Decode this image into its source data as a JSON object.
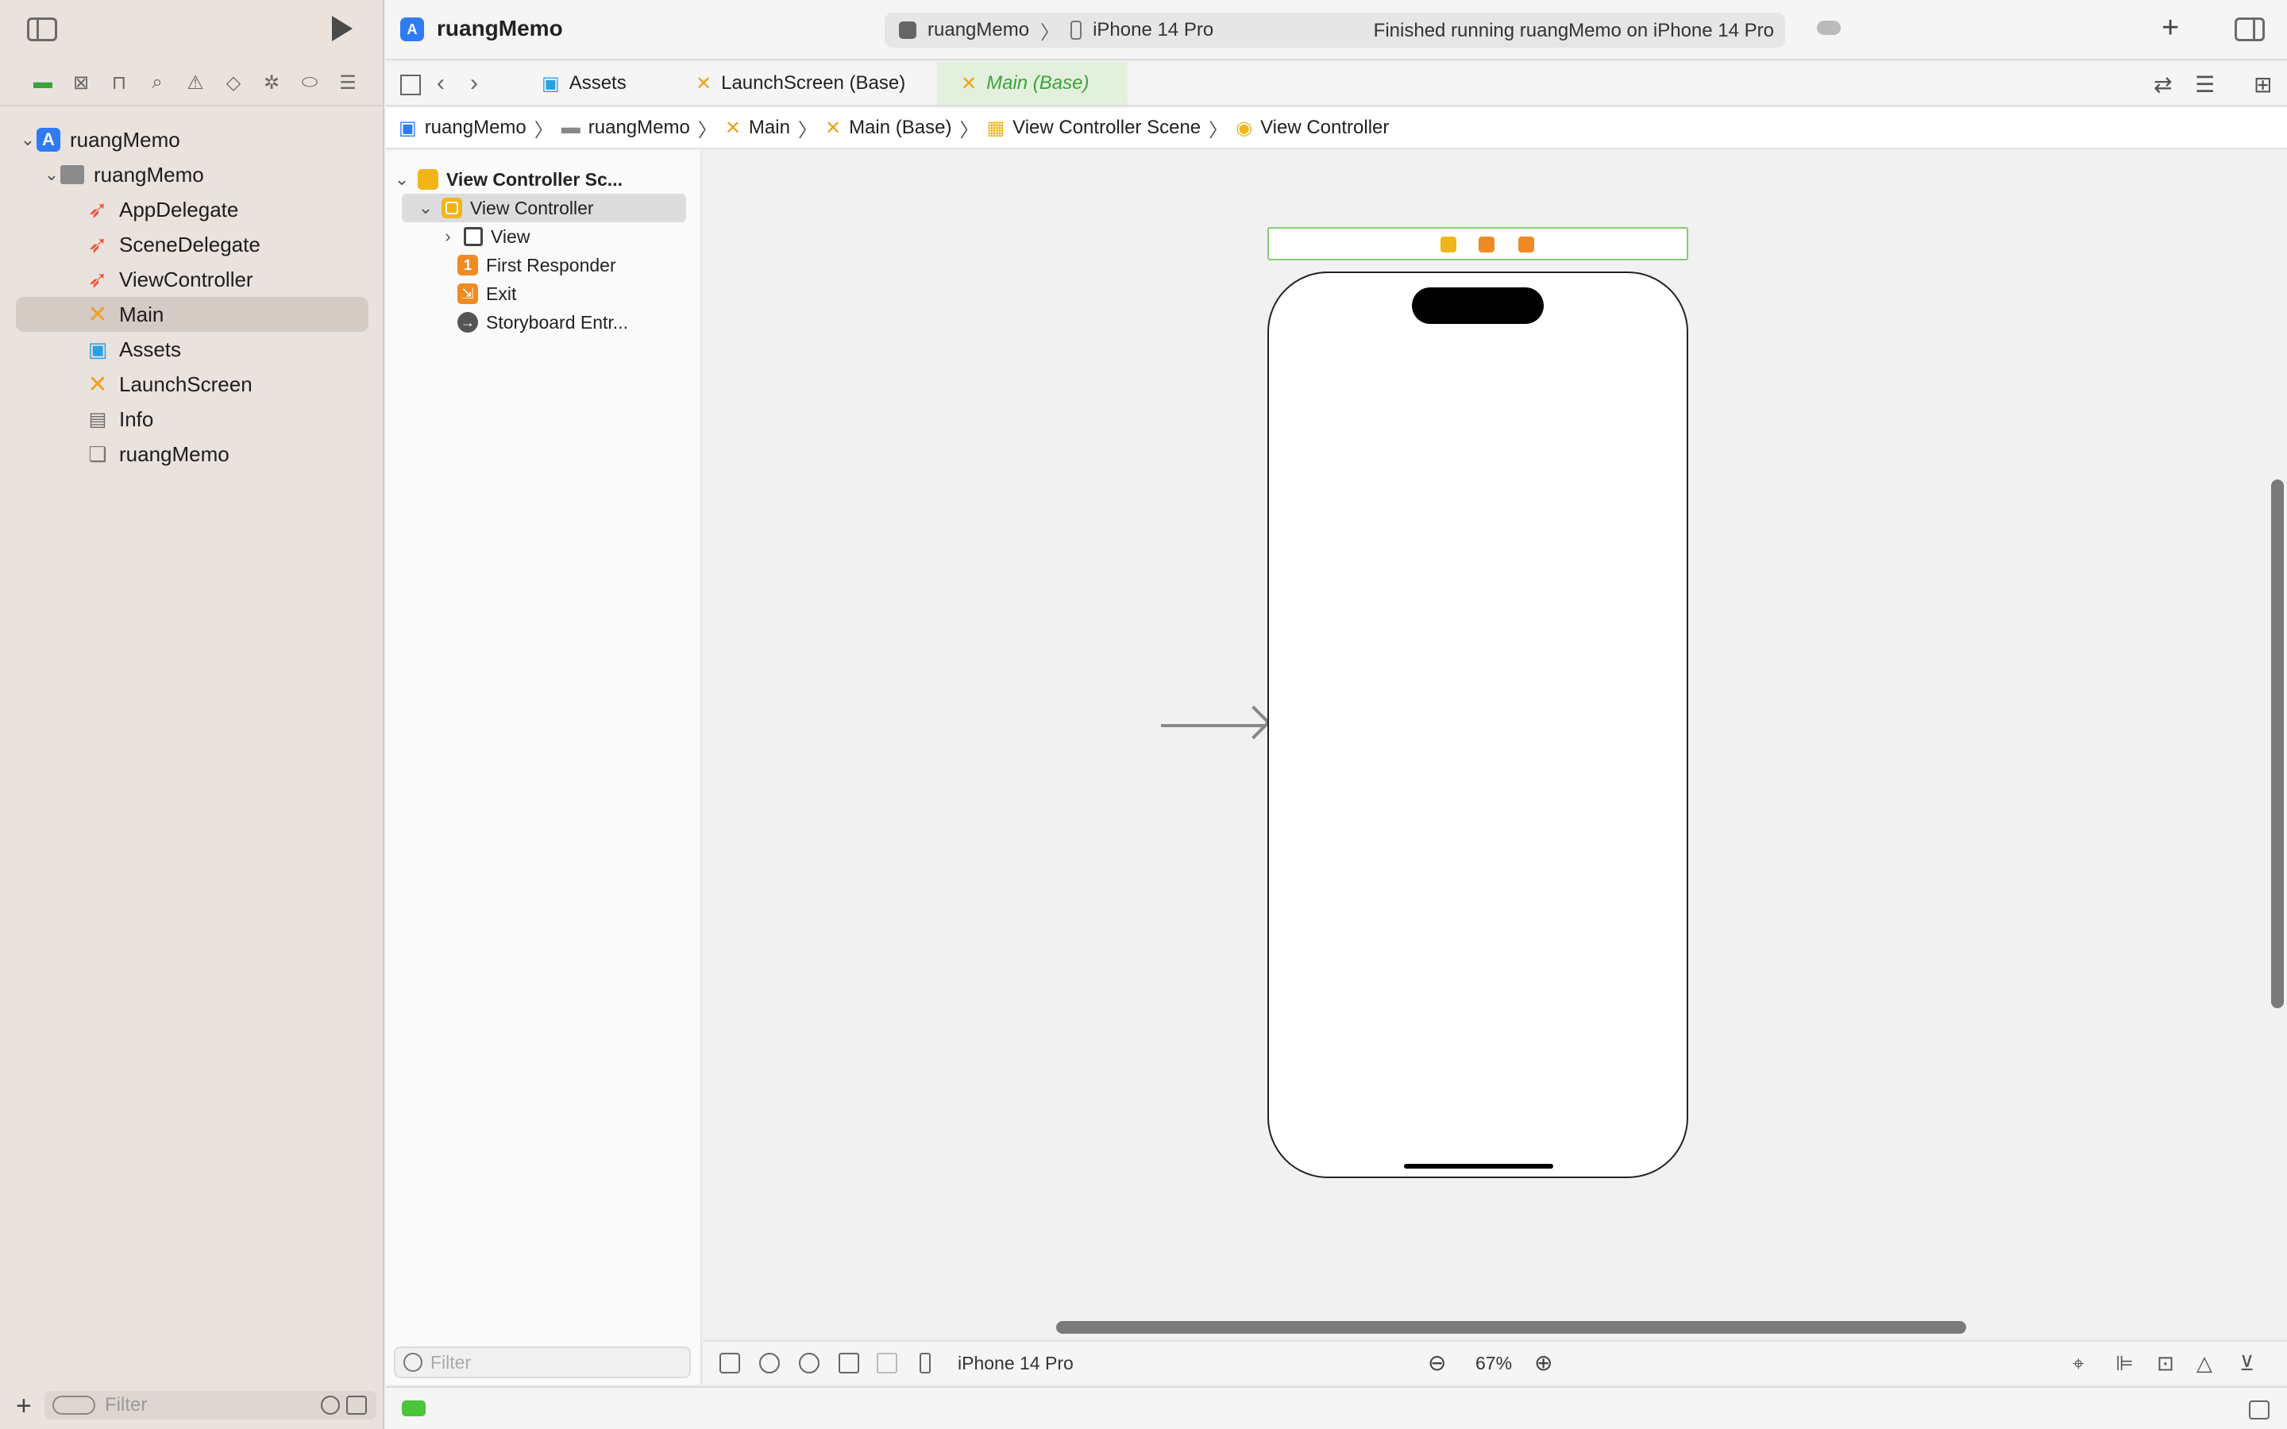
{
  "toolbar": {
    "project_title": "ruangMemo",
    "scheme": "ruangMemo",
    "device": "iPhone 14 Pro",
    "status": "Finished running ruangMemo on iPhone 14 Pro"
  },
  "navigator": {
    "items": [
      {
        "label": "ruangMemo",
        "icon": "app-icon"
      },
      {
        "label": "ruangMemo",
        "icon": "folder-icon"
      },
      {
        "label": "AppDelegate",
        "icon": "swift-icon"
      },
      {
        "label": "SceneDelegate",
        "icon": "swift-icon"
      },
      {
        "label": "ViewController",
        "icon": "swift-icon"
      },
      {
        "label": "Main",
        "icon": "storyboard-icon"
      },
      {
        "label": "Assets",
        "icon": "assets-icon"
      },
      {
        "label": "LaunchScreen",
        "icon": "storyboard-icon"
      },
      {
        "label": "Info",
        "icon": "plist-icon"
      },
      {
        "label": "ruangMemo",
        "icon": "entitlements-icon"
      }
    ],
    "filter_placeholder": "Filter"
  },
  "tabs": [
    {
      "label": "Assets"
    },
    {
      "label": "LaunchScreen (Base)"
    },
    {
      "label": "Main (Base)"
    }
  ],
  "jumpbar": [
    "ruangMemo",
    "ruangMemo",
    "Main",
    "Main (Base)",
    "View Controller Scene",
    "View Controller"
  ],
  "outline": {
    "scene": "View Controller Sc...",
    "view_controller": "View Controller",
    "view": "View",
    "first_responder": "First Responder",
    "exit": "Exit",
    "storyboard_entry": "Storyboard Entr...",
    "filter_placeholder": "Filter"
  },
  "canvas": {
    "device": "iPhone 14 Pro",
    "zoom": "67%"
  },
  "colors": {
    "accent_green": "#3aa33a",
    "sidebar_bg": "#e9e2dd",
    "storyboard_orange": "#f08a24",
    "swift_red": "#f05138"
  }
}
